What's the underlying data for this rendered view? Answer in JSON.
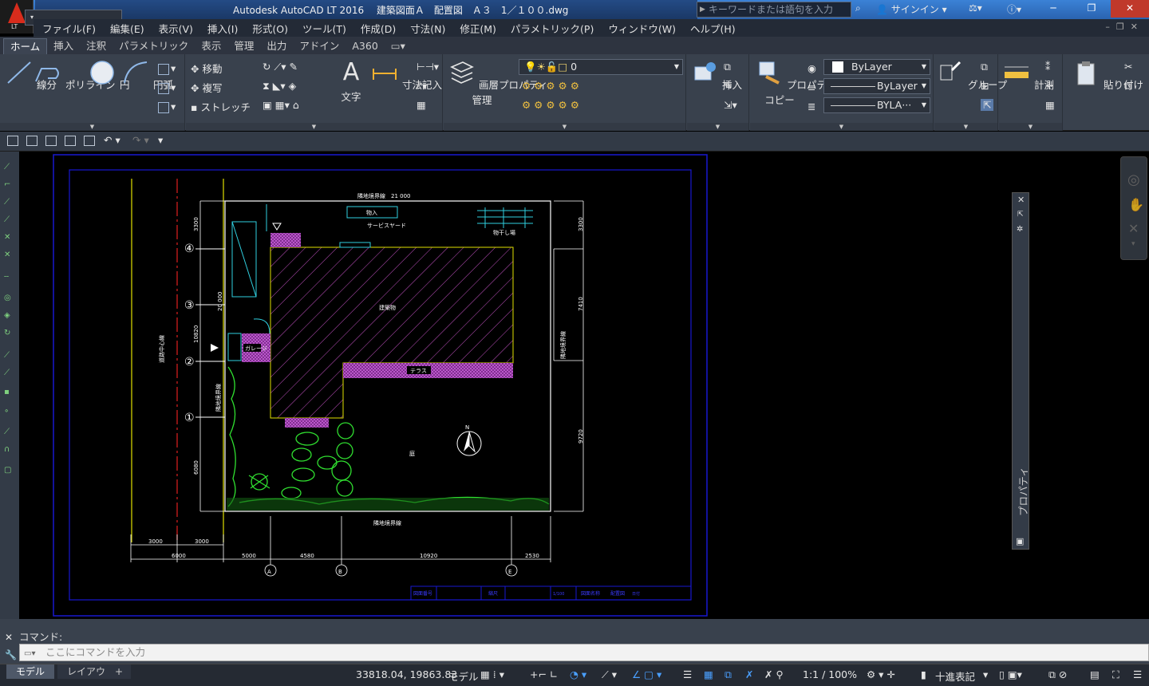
{
  "window": {
    "title": "Autodesk AutoCAD LT 2016　 建築図面Ａ　配置図　Ａ３　1／１００.dwg",
    "logo_text": "LT",
    "search_placeholder": "キーワードまたは語句を入力",
    "signin": "サインイン"
  },
  "menu": [
    "ファイル(F)",
    "編集(E)",
    "表示(V)",
    "挿入(I)",
    "形式(O)",
    "ツール(T)",
    "作成(D)",
    "寸法(N)",
    "修正(M)",
    "パラメトリック(P)",
    "ウィンドウ(W)",
    "ヘルプ(H)"
  ],
  "ribbon_tabs": [
    "ホーム",
    "挿入",
    "注釈",
    "パラメトリック",
    "表示",
    "管理",
    "出力",
    "アドイン",
    "A360"
  ],
  "ribbon": {
    "draw": {
      "line": "線分",
      "polyline": "ポリライン",
      "circle": "円",
      "arc": "円弧"
    },
    "modify": {
      "move": "移動",
      "copy": "複写",
      "stretch": "ストレッチ"
    },
    "annotation": {
      "text": "文字",
      "dimension": "寸法記入"
    },
    "layers": {
      "layer_props_1": "画層プロパティ",
      "layer_props_2": "管理",
      "current_layer": "0"
    },
    "block": {
      "insert": "挿入"
    },
    "properties": {
      "match_1": "プロパティ",
      "match_2": "コピー",
      "color": "ByLayer",
      "linetype": "ByLayer",
      "lineweight": "BYLA···"
    },
    "groups": {
      "group": "グループ"
    },
    "utilities": {
      "measure": "計測"
    },
    "clipboard": {
      "paste": "貼り付け"
    }
  },
  "drawing": {
    "north_mark": "N",
    "top_boundary_label": "隣地境界線　21 000",
    "bottom_boundary_label": "隣地境界線",
    "left_road_label": "道路中心線",
    "left_boundary_label": "隣地境界線",
    "right_boundary_label": "隣地境界線",
    "building": "建築物",
    "terrace": "テラス",
    "garage": "ガレージ",
    "storage": "物入",
    "service_yard": "サービスヤード",
    "drying_area": "物干し場",
    "garden": "庭",
    "grid_numbers": [
      "④",
      "③",
      "②",
      "①"
    ],
    "grid_letters": [
      "A",
      "B",
      "E"
    ],
    "dim_left_total": "20 000",
    "dim_left": [
      "3300",
      "10820",
      "6080"
    ],
    "dim_right": [
      "3300",
      "7410",
      "9720"
    ],
    "dim_bottom": [
      "5000",
      "4580",
      "10920",
      "2530"
    ],
    "dim_road": [
      "3000",
      "3000",
      "6000"
    ],
    "title_block": [
      "図面番号",
      "縮尺",
      "1/100",
      "図面名称",
      "配置図",
      "日付"
    ]
  },
  "command": {
    "label": "コマンド:",
    "placeholder": "ここにコマンドを入力"
  },
  "layout_tabs": [
    "モデル",
    "レイアウト1"
  ],
  "status": {
    "coords": "33818.04, 19863.83",
    "model": "モデル",
    "scale": "1:1 / 100%",
    "units": "十進表記"
  },
  "palette": {
    "properties_label": "プロパティ"
  }
}
